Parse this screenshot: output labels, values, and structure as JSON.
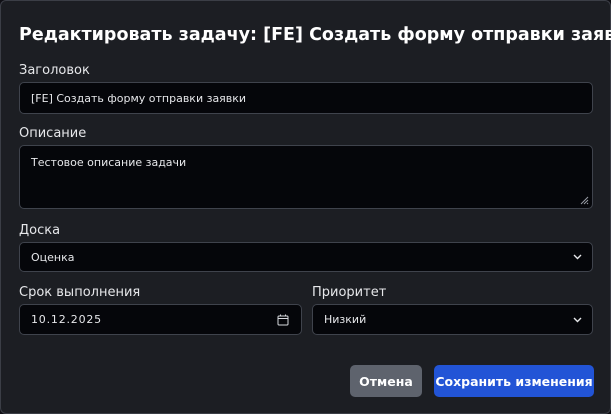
{
  "dialog": {
    "title": "Редактировать задачу: [FE] Создать форму отправки заявки"
  },
  "form": {
    "title_label": "Заголовок",
    "title_value": "[FE] Создать форму отправки заявки",
    "description_label": "Описание",
    "description_value": "Тестовое описание задачи",
    "board_label": "Доска",
    "board_value": "Оценка",
    "due_date_label": "Срок выполнения",
    "due_date_value": "10.12.2025",
    "priority_label": "Приоритет",
    "priority_value": "Низкий"
  },
  "buttons": {
    "cancel_label": "Отмена",
    "save_label": "Сохранить изменения"
  },
  "colors": {
    "dialog_background": "#1c1e23",
    "field_background": "#05060a",
    "cancel_button": "#5e636d",
    "primary_button": "#2254d6"
  },
  "icons": {
    "select_arrow": "chevron-down-icon",
    "date_picker": "calendar-icon",
    "textarea_resize": "resize-grip-icon"
  }
}
